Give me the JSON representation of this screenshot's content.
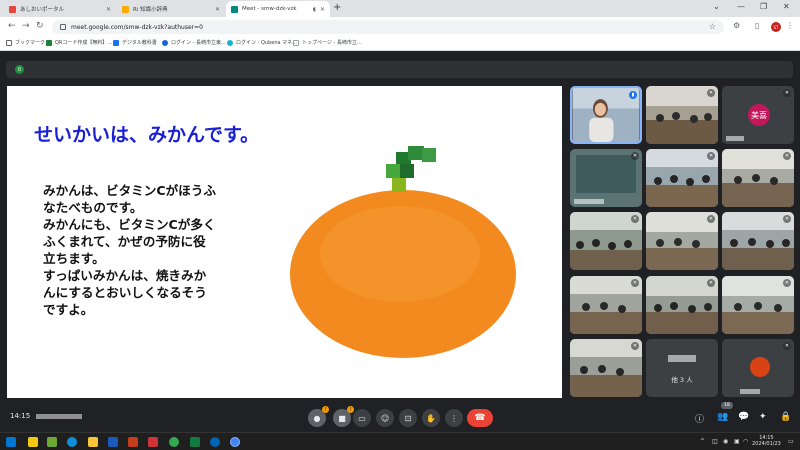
{
  "browser": {
    "tabs": [
      {
        "title": "あしおいポータル",
        "favicon_color": "#e8453c"
      },
      {
        "title": "Ri 知識小辞典",
        "favicon_color": "#f9ab00"
      },
      {
        "title": "Meet - smw-dzk-vzk",
        "favicon_color": "#00897b",
        "active": true
      }
    ],
    "url": "meet.google.com/smw-dzk-vzk?authuser=0",
    "bookmarks": [
      {
        "label": "ブックマーク",
        "color": "#5f6368"
      },
      {
        "label": "QRコード作成【無料】...",
        "color": "#188038"
      },
      {
        "label": "デジタル教科書",
        "color": "#1a73e8"
      },
      {
        "label": "ログイン - 長崎市立東...",
        "color": "#1967d2"
      },
      {
        "label": "ログイン - Qubena マネ...",
        "color": "#12b5cb"
      },
      {
        "label": "トップページ - 長崎市立...",
        "color": "#9aa0a6"
      }
    ],
    "profile_initials": "ST"
  },
  "meet": {
    "presenter_badge": "0",
    "clock": "14:15",
    "others_label": "他 3 人",
    "avatar_name": "美喜",
    "participant_count": "18"
  },
  "slide": {
    "title": "せいかいは、みかんです。",
    "body_lines": [
      "みかんは、ビタミンCがほうふ",
      "なたべものです。",
      "みかんにも、ビタミンCが多く",
      "ふくまれて、かぜの予防に役",
      "立ちます。",
      "すっぱいみかんは、焼きみか",
      "んにするとおいしくなるそう",
      "ですよ。"
    ],
    "title_color": "#1a20d6"
  },
  "taskbar": {
    "time": "14:15",
    "date": "2024/01/23"
  }
}
